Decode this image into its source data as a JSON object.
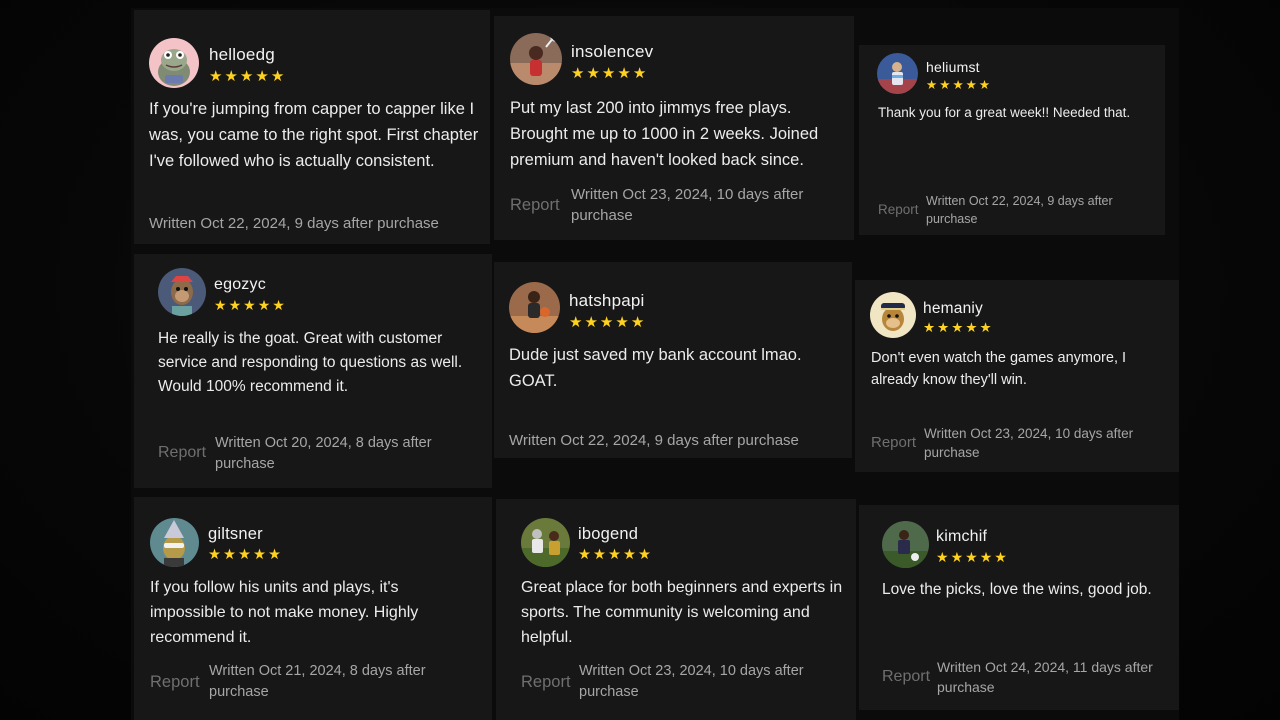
{
  "reviews": [
    {
      "username": "helloedg",
      "stars": 5,
      "text": "If you're jumping from capper to capper like I was, you came to the right spot. First chapter I've followed who is actually consistent.",
      "report": "",
      "written": "Written Oct 22, 2024, 9 days after purchase"
    },
    {
      "username": "insolencev",
      "stars": 5,
      "text": "Put my last 200 into jimmys free plays. Brought me up to 1000 in 2 weeks. Joined premium and haven't looked back since.",
      "report": "Report",
      "written": "Written Oct 23, 2024, 10 days after purchase"
    },
    {
      "username": "heliumst",
      "stars": 5,
      "text": "Thank you for a great week!! Needed that.",
      "report": "Report",
      "written": "Written Oct 22, 2024, 9 days after purchase"
    },
    {
      "username": "egozyc",
      "stars": 5,
      "text": "He really is the goat. Great with customer service and responding to questions as well. Would 100% recommend it.",
      "report": "Report",
      "written": "Written Oct 20, 2024, 8 days after purchase"
    },
    {
      "username": "hatshpapi",
      "stars": 5,
      "text": "Dude just saved my bank account lmao. GOAT.",
      "report": "",
      "written": "Written Oct 22, 2024, 9 days after purchase"
    },
    {
      "username": "hemaniy",
      "stars": 5,
      "text": "Don't even watch the games anymore, I already know they'll win.",
      "report": "Report",
      "written": "Written Oct 23, 2024, 10 days after purchase"
    },
    {
      "username": "giltsner",
      "stars": 5,
      "text": "If you follow his units and plays, it's impossible to not make money. Highly recommend it.",
      "report": "Report",
      "written": "Written Oct 21, 2024, 8 days after purchase"
    },
    {
      "username": "ibogend",
      "stars": 5,
      "text": "Great place for both beginners and experts in sports. The community is welcoming and helpful.",
      "report": "Report",
      "written": "Written Oct 23, 2024, 10 days after purchase"
    },
    {
      "username": "kimchif",
      "stars": 5,
      "text": "Love the picks, love the wins, good job.",
      "report": "Report",
      "written": "Written Oct 24, 2024, 11 days after purchase"
    }
  ],
  "avatars": [
    {
      "icon": "frog-cartoon-avatar-icon",
      "bg": "#f3c3c7"
    },
    {
      "icon": "tennis-player-photo-avatar-icon",
      "bg": "#7a5a4a"
    },
    {
      "icon": "soccer-player-photo-avatar-icon",
      "bg": "#3a5a9a"
    },
    {
      "icon": "ape-cartoon-avatar-icon",
      "bg": "#4a5a78"
    },
    {
      "icon": "basketball-player-photo-avatar-icon",
      "bg": "#9a6a4a"
    },
    {
      "icon": "ape-sailor-cartoon-avatar-icon",
      "bg": "#f1e6c4"
    },
    {
      "icon": "ape-wizard-cartoon-avatar-icon",
      "bg": "#5e8a90"
    },
    {
      "icon": "football-players-photo-avatar-icon",
      "bg": "#6a7a3a"
    },
    {
      "icon": "soccer-players-photo-avatar-icon",
      "bg": "#4f6a4a"
    }
  ],
  "colors": {
    "star": "#ffd21f",
    "card": "#171717",
    "report": "#6f6f6f",
    "meta": "#a6a6a6"
  }
}
